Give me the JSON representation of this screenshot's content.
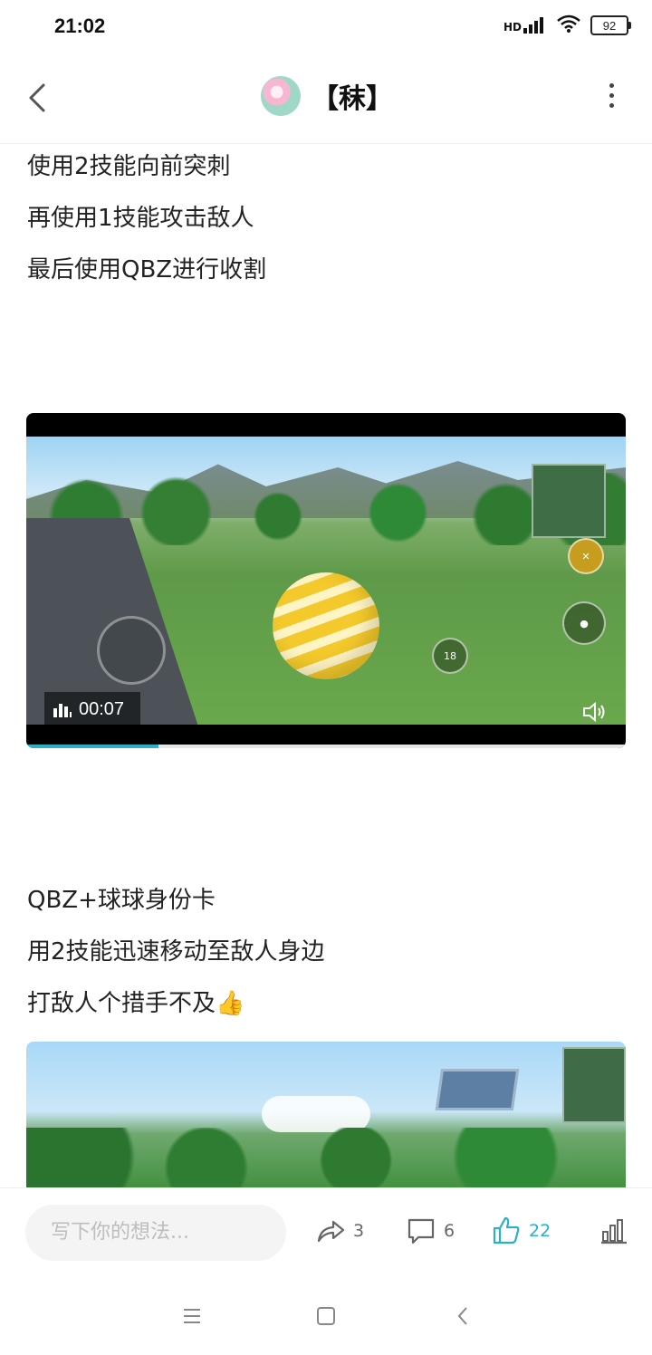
{
  "status_bar": {
    "time": "21:02",
    "network": "HD",
    "battery": "92"
  },
  "header": {
    "title": "【秣】"
  },
  "content": {
    "paragraphs_top": [
      "使用2技能向前突刺",
      "再使用1技能攻击敌人",
      "最后使用QBZ进行收割"
    ],
    "video": {
      "duration": "00:07",
      "progress": 0.22
    },
    "paragraphs_bottom": [
      "QBZ+球球身份卡",
      "用2技能迅速移动至敌人身边",
      "打敌人个措手不及👍"
    ]
  },
  "bottom_bar": {
    "comment_placeholder": "写下你的想法...",
    "share_count": "3",
    "comment_count": "6",
    "like_count": "22"
  },
  "colors": {
    "accent": "#2bb0c7",
    "text": "#222222",
    "muted": "#666666"
  }
}
